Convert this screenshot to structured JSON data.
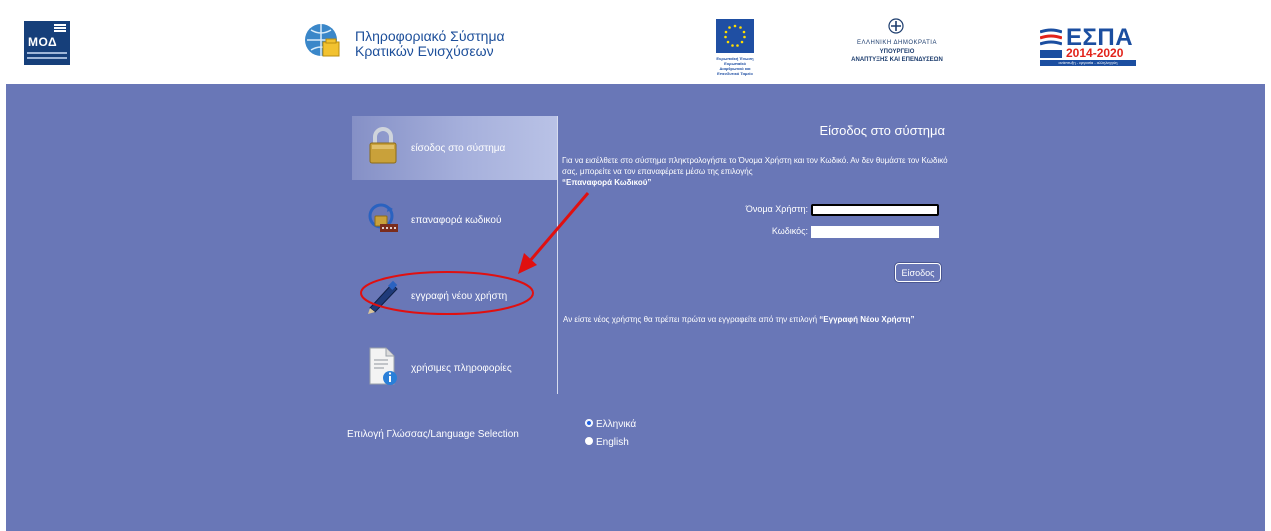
{
  "header": {
    "moda_logo_text": "ΜΟΔ",
    "system_name_line1": "Πληροφοριακό Σύστημα",
    "system_name_line2": "Κρατικών Ενισχύσεων",
    "eu_logo_caption": "Ευρωπαϊκή Ένωση Ευρωπαϊκό Διαρθρωτικό και Επενδυτικό Ταμείο",
    "greece_line1": "ΕΛΛΗΝΙΚΗ ΔΗΜΟΚΡΑΤΙΑ",
    "greece_line2": "ΥΠΟΥΡΓΕΙΟ",
    "greece_line3": "ΑΝΑΠΤΥΞΗΣ ΚΑΙ ΕΠΕΝΔΥΣΕΩΝ",
    "espa_word": "ΕΣΠΑ",
    "espa_years": "2014-2020",
    "espa_tagline": "ανάπτυξη - εργασία - αλληλεγγύη"
  },
  "menu": {
    "items": [
      {
        "label": "είσοδος στο σύστημα",
        "icon": "padlock-icon",
        "active": true
      },
      {
        "label": "επαναφορά κωδικού",
        "icon": "password-reset-icon",
        "active": false
      },
      {
        "label": "εγγραφή νέου χρήστη",
        "icon": "pen-icon",
        "active": false
      },
      {
        "label": "χρήσιμες πληροφορίες",
        "icon": "document-info-icon",
        "active": false
      }
    ]
  },
  "login": {
    "title": "Είσοδος στο σύστημα",
    "intro_text": "Για να εισέλθετε στο σύστημα πληκτρολογήστε το Όνομα Χρήστη και τον Κωδικό. Αν δεν θυμάστε τον Κωδικό σας, μπορείτε να τον επαναφέρετε μέσω της επιλογής",
    "intro_link": "“Επαναφορά Κωδικού”",
    "username_label": "Όνομα Χρήστη:",
    "username_value": "",
    "password_label": "Κωδικός:",
    "password_value": "",
    "submit_label": "Είσοδος",
    "new_user_text": "Αν είστε νέος χρήστης θα πρέπει πρώτα να εγγραφείτε από την επιλογή",
    "new_user_link": "“Εγγραφή Νέου Χρήστη”"
  },
  "language": {
    "label": "Επιλογή Γλώσσας/Language Selection",
    "options": [
      {
        "label": "Ελληνικά",
        "selected": true
      },
      {
        "label": "English",
        "selected": false
      }
    ]
  },
  "colors": {
    "main_background": "#6977b7",
    "header_background": "#ffffff",
    "annotation_red": "#e01010"
  }
}
